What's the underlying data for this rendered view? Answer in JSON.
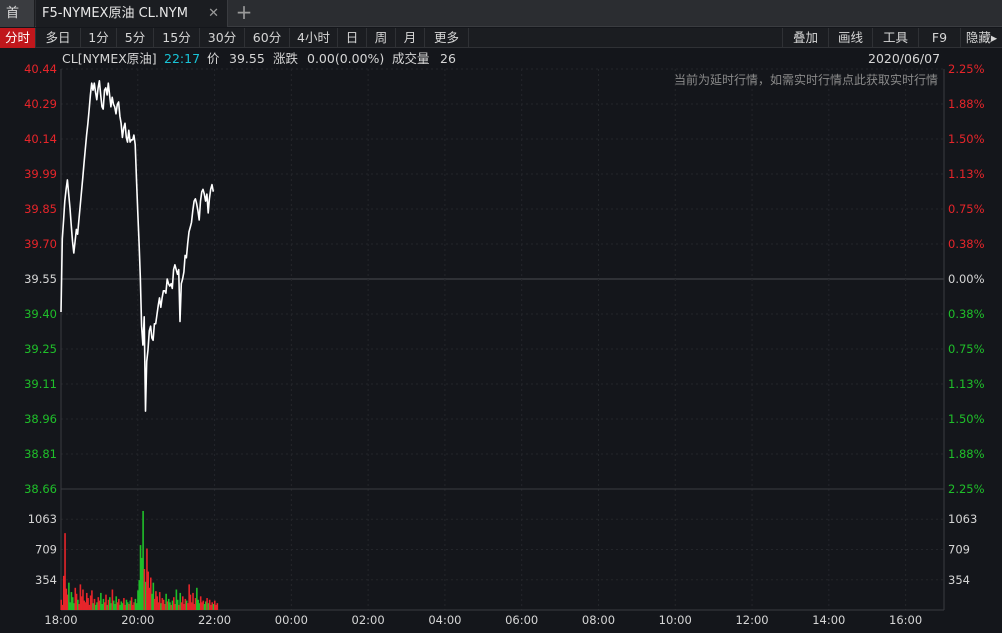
{
  "tabs": {
    "home_label": "首页",
    "active_label": "F5-NYMEX原油 CL.NYM",
    "close_glyph": "✕",
    "add_glyph": "+"
  },
  "toolbar": {
    "periods": [
      "分时",
      "多日",
      "1分",
      "5分",
      "15分",
      "30分",
      "60分",
      "4小时",
      "日",
      "周",
      "月",
      "更多"
    ],
    "active_period": "分时",
    "tools": [
      "叠加",
      "画线",
      "工具",
      "F9",
      "隐藏▸"
    ]
  },
  "info": {
    "symbol": "CL[NYMEX原油]",
    "time": "22:17",
    "price_label": "价",
    "price": "39.55",
    "change_label": "涨跌",
    "change": "0.00(0.00%)",
    "volume_label": "成交量",
    "volume": "26",
    "date": "2020/06/07"
  },
  "chart_data": {
    "type": "line",
    "notice": "当前为延时行情，如需实时行情点此获取实时行情",
    "base_price": 39.55,
    "price_axis": {
      "labels": [
        "40.44",
        "40.29",
        "40.14",
        "39.99",
        "39.85",
        "39.70",
        "39.55",
        "39.40",
        "39.25",
        "39.11",
        "38.96",
        "38.81",
        "38.66"
      ],
      "ylim": [
        38.66,
        40.44
      ]
    },
    "pct_axis": {
      "labels": [
        "2.25%",
        "1.88%",
        "1.50%",
        "1.13%",
        "0.75%",
        "0.38%",
        "0.00%",
        "0.38%",
        "0.75%",
        "1.13%",
        "1.50%",
        "1.88%",
        "2.25%"
      ]
    },
    "volume_axis": {
      "labels": [
        "1063",
        "709",
        "354"
      ],
      "values": [
        1063,
        709,
        354
      ],
      "ylim": [
        0,
        1417
      ]
    },
    "time_axis": {
      "labels": [
        "18:00",
        "20:00",
        "22:00",
        "00:00",
        "02:00",
        "04:00",
        "06:00",
        "08:00",
        "10:00",
        "12:00",
        "14:00",
        "16:00"
      ],
      "range_minutes": [
        0,
        1380
      ]
    },
    "price_series": {
      "minutes": [
        0,
        2,
        4,
        6,
        8,
        10,
        12,
        14,
        16,
        18,
        20,
        22,
        24,
        26,
        28,
        30,
        32,
        34,
        36,
        38,
        40,
        42,
        44,
        46,
        48,
        50,
        52,
        54,
        56,
        58,
        60,
        62,
        64,
        66,
        68,
        70,
        72,
        74,
        76,
        78,
        80,
        82,
        84,
        86,
        88,
        90,
        92,
        94,
        96,
        98,
        100,
        102,
        104,
        106,
        108,
        110,
        112,
        114,
        116,
        118,
        120,
        122,
        124,
        126,
        128,
        130,
        132,
        134,
        136,
        138,
        140,
        142,
        144,
        146,
        148,
        150,
        152,
        154,
        156,
        158,
        160,
        162,
        164,
        166,
        168,
        170,
        172,
        174,
        176,
        178,
        180,
        182,
        184,
        186,
        188,
        190,
        192,
        194,
        196,
        198,
        200,
        202,
        204,
        206,
        208,
        210,
        212,
        214,
        216,
        218,
        220,
        222,
        224,
        226,
        228,
        230,
        232,
        234,
        236,
        238,
        240,
        242,
        244,
        246,
        248,
        250,
        252,
        254,
        256,
        258,
        260,
        262,
        264,
        266,
        268,
        270,
        272,
        274,
        276,
        278,
        280,
        282,
        284,
        286,
        288,
        290,
        292,
        294,
        296,
        298,
        300,
        302,
        304,
        306,
        308,
        310,
        312,
        314,
        316,
        318,
        320,
        322,
        324,
        326,
        328,
        330,
        332,
        334,
        336,
        338,
        340,
        342,
        344,
        346
      ],
      "values": [
        39.41,
        39.72,
        39.8,
        39.88,
        39.93,
        39.97,
        39.91,
        39.85,
        39.78,
        39.71,
        39.66,
        39.71,
        39.76,
        39.74,
        39.8,
        39.86,
        39.92,
        39.98,
        40.04,
        40.1,
        40.16,
        40.21,
        40.27,
        40.33,
        40.38,
        40.35,
        40.38,
        40.34,
        40.31,
        40.36,
        40.39,
        40.33,
        40.28,
        40.27,
        40.35,
        40.36,
        40.33,
        40.38,
        40.33,
        40.28,
        40.32,
        40.29,
        40.28,
        40.25,
        40.29,
        40.3,
        40.24,
        40.21,
        40.15,
        40.19,
        40.21,
        40.15,
        40.13,
        40.18,
        40.13,
        40.14,
        40.14,
        40.16,
        40.12,
        39.97,
        39.83,
        39.7,
        39.56,
        39.35,
        39.27,
        39.39,
        38.99,
        39.2,
        39.25,
        39.33,
        39.35,
        39.3,
        39.29,
        39.36,
        39.36,
        39.4,
        39.44,
        39.47,
        39.43,
        39.47,
        39.5,
        39.5,
        39.49,
        39.55,
        39.53,
        39.52,
        39.53,
        39.51,
        39.59,
        39.61,
        39.59,
        39.57,
        39.59,
        39.37,
        39.53,
        39.55,
        39.58,
        39.65,
        39.64,
        39.7,
        39.75,
        39.77,
        39.79,
        39.84,
        39.88,
        39.89,
        39.87,
        39.84,
        39.8,
        39.88,
        39.92,
        39.93,
        39.91,
        39.88,
        39.91,
        39.83,
        39.89,
        39.93,
        39.95,
        39.92
      ],
      "color": "#ffffff"
    },
    "volume_series": {
      "values": [
        120,
        60,
        400,
        900,
        250,
        180,
        320,
        90,
        210,
        150,
        80,
        260,
        190,
        120,
        70,
        300,
        160,
        240,
        110,
        90,
        200,
        140,
        60,
        170,
        230,
        80,
        130,
        60,
        90,
        150,
        110,
        200,
        70,
        130,
        90,
        180,
        60,
        120,
        150,
        80,
        240,
        110,
        70,
        160,
        90,
        130,
        60,
        100,
        80,
        140,
        60,
        120,
        90,
        70,
        110,
        150,
        60,
        90,
        130,
        80,
        230,
        350,
        760,
        610,
        1160,
        480,
        330,
        720,
        450,
        260,
        380,
        190,
        320,
        130,
        220,
        160,
        90,
        210,
        80,
        140,
        120,
        70,
        190,
        100,
        130,
        90,
        60,
        110,
        150,
        70,
        240,
        120,
        60,
        200,
        90,
        160,
        70,
        130,
        110,
        80,
        300,
        180,
        90,
        200,
        70,
        140,
        260,
        120,
        80,
        160,
        90,
        110,
        70,
        100,
        140,
        80,
        120,
        60,
        90,
        70,
        110,
        60,
        80
      ],
      "colors": [
        "#e6252a",
        "#1fbf2a"
      ]
    }
  }
}
